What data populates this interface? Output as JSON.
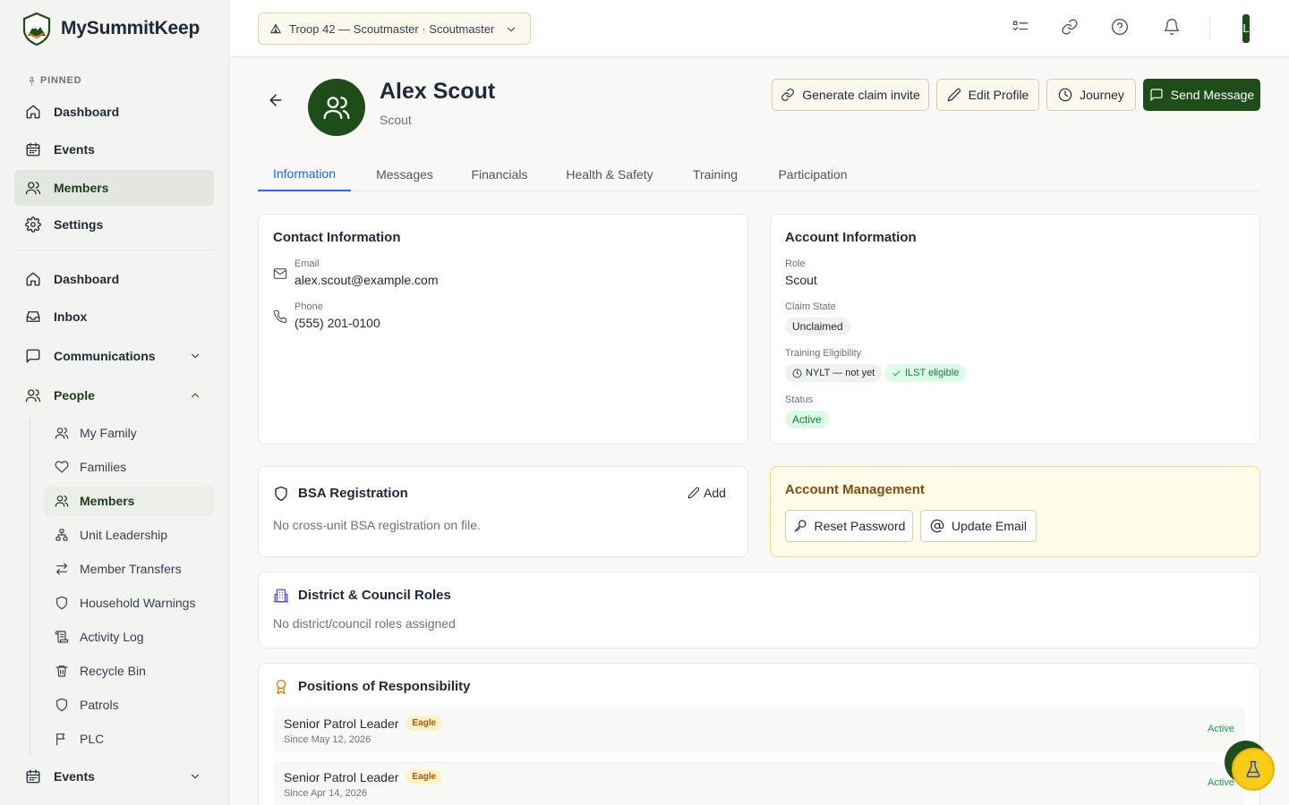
{
  "brand": {
    "name": "MySummitKeep"
  },
  "sidebar": {
    "pinned_label": "PINNED",
    "pinned": [
      {
        "label": "Dashboard",
        "icon": "home-icon"
      },
      {
        "label": "Events",
        "icon": "calendar-icon"
      },
      {
        "label": "Members",
        "icon": "users-icon"
      },
      {
        "label": "Settings",
        "icon": "gear-icon"
      }
    ],
    "main": [
      {
        "label": "Dashboard",
        "icon": "home-icon"
      },
      {
        "label": "Inbox",
        "icon": "inbox-icon"
      },
      {
        "label": "Communications",
        "icon": "message-square-icon"
      },
      {
        "label": "People",
        "icon": "users-icon"
      }
    ],
    "people_sub": [
      {
        "label": "My Family",
        "icon": "users-icon"
      },
      {
        "label": "Families",
        "icon": "heart-icon"
      },
      {
        "label": "Members",
        "icon": "users-icon"
      },
      {
        "label": "Unit Leadership",
        "icon": "org-chart-icon"
      },
      {
        "label": "Member Transfers",
        "icon": "arrows-swap-icon"
      },
      {
        "label": "Household Warnings",
        "icon": "shield-icon"
      },
      {
        "label": "Activity Log",
        "icon": "scroll-icon"
      },
      {
        "label": "Recycle Bin",
        "icon": "trash-icon"
      },
      {
        "label": "Patrols",
        "icon": "shield-icon"
      },
      {
        "label": "PLC",
        "icon": "flag-icon"
      }
    ],
    "events_label": "Events"
  },
  "topbar": {
    "unit_selector": "Troop 42 — Scoutmaster · Scoutmaster",
    "avatar_initial": "L"
  },
  "profile": {
    "name": "Alex Scout",
    "role": "Scout",
    "actions": {
      "claim": "Generate claim invite",
      "edit": "Edit Profile",
      "journey": "Journey",
      "message": "Send Message"
    }
  },
  "tabs": [
    "Information",
    "Messages",
    "Financials",
    "Health & Safety",
    "Training",
    "Participation"
  ],
  "contact": {
    "title": "Contact Information",
    "email_label": "Email",
    "email": "alex.scout@example.com",
    "phone_label": "Phone",
    "phone": "(555) 201-0100"
  },
  "account": {
    "title": "Account Information",
    "role_label": "Role",
    "role": "Scout",
    "claim_label": "Claim State",
    "claim": "Unclaimed",
    "training_label": "Training Eligibility",
    "nylt": "NYLT — not yet",
    "ilst": "ILST eligible",
    "status_label": "Status",
    "status": "Active"
  },
  "bsa": {
    "title": "BSA Registration",
    "add": "Add",
    "empty": "No cross-unit BSA registration on file."
  },
  "account_mgmt": {
    "title": "Account Management",
    "reset": "Reset Password",
    "update": "Update Email"
  },
  "district": {
    "title": "District & Council Roles",
    "empty": "No district/council roles assigned"
  },
  "positions": {
    "title": "Positions of Responsibility",
    "items": [
      {
        "title": "Senior Patrol Leader",
        "badge": "Eagle",
        "since": "Since May 12, 2026",
        "status": "Active"
      },
      {
        "title": "Senior Patrol Leader",
        "badge": "Eagle",
        "since": "Since Apr 14, 2026",
        "status": "Active"
      }
    ]
  },
  "colors": {
    "primary": "#1f4d1a",
    "accent": "#2563eb",
    "warn": "#fefbe8",
    "success": "#16a34a"
  }
}
